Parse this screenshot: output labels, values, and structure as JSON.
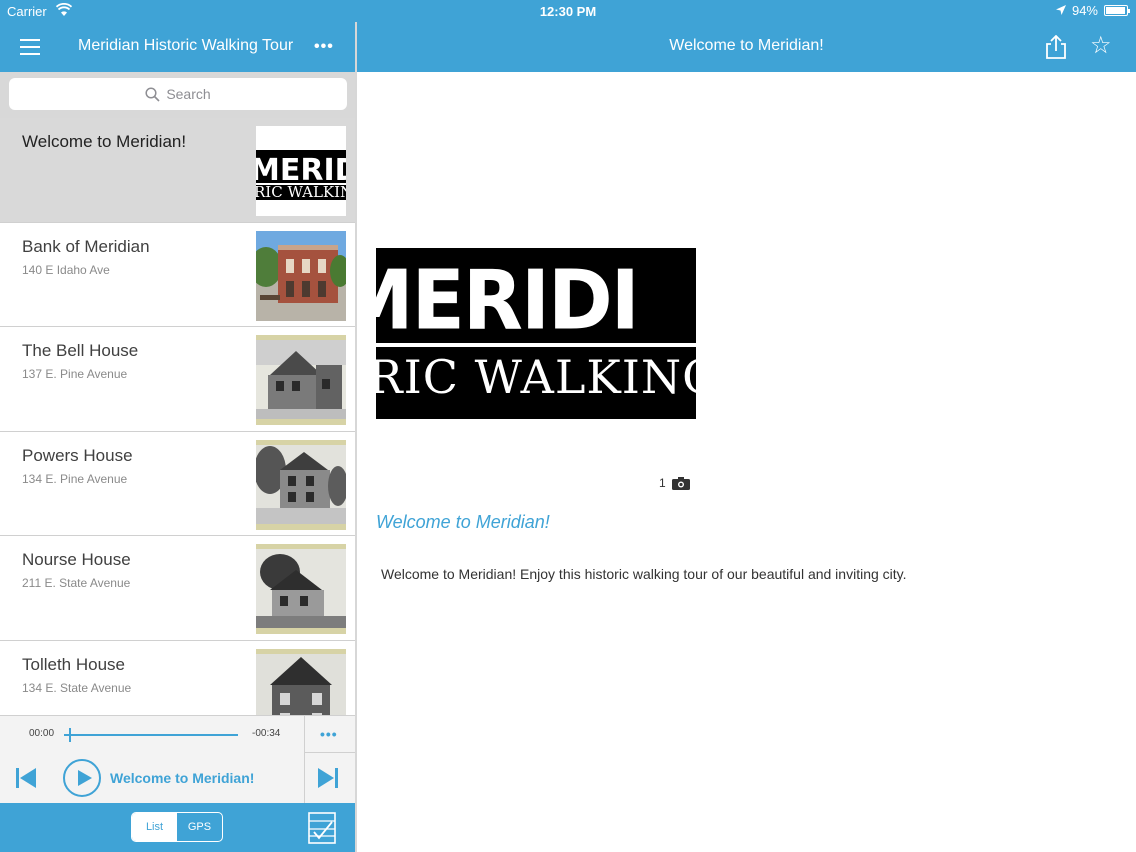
{
  "status_bar": {
    "carrier": "Carrier",
    "time": "12:30 PM",
    "battery": "94%",
    "battery_level": 0.94
  },
  "left_nav": {
    "title": "Meridian Historic Walking Tour"
  },
  "right_nav": {
    "title": "Welcome to Meridian!"
  },
  "search": {
    "placeholder": "Search"
  },
  "list": {
    "items": [
      {
        "name": "Welcome to Meridian!",
        "address": "",
        "selected": true
      },
      {
        "name": "Bank of Meridian",
        "address": "140 E Idaho Ave"
      },
      {
        "name": "The Bell House",
        "address": "137 E. Pine Avenue"
      },
      {
        "name": "Powers House",
        "address": "134 E. Pine Avenue"
      },
      {
        "name": "Nourse House",
        "address": "211 E. State Avenue"
      },
      {
        "name": "Tolleth House",
        "address": "134 E. State Avenue"
      }
    ]
  },
  "thumb_logo": {
    "line1": "MERIDI",
    "line2": "RIC WALKING"
  },
  "player": {
    "elapsed": "00:00",
    "remaining": "-00:34",
    "progress": 0.03,
    "now_playing": "Welcome to Meridian!"
  },
  "bottom_bar": {
    "list_label": "List",
    "gps_label": "GPS"
  },
  "content": {
    "hero_line1": "MERIDI",
    "hero_line2": "RIC WALKING",
    "photo_count": "1",
    "title": "Welcome to Meridian!",
    "body": "Welcome to Meridian!  Enjoy this historic walking tour of our beautiful and inviting city."
  },
  "colors": {
    "accent": "#3fa3d6",
    "selected_row": "#d9d9d9"
  }
}
